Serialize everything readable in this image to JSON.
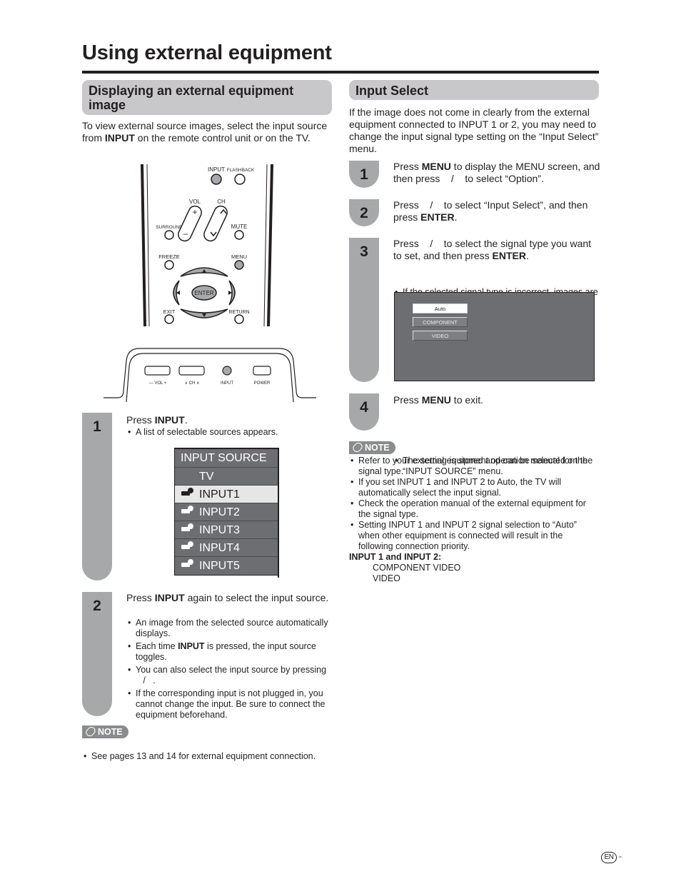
{
  "page": {
    "title": "Using external equipment",
    "footer_lang": "EN",
    "footer_dash": "-"
  },
  "left": {
    "heading": "Displaying an external equipment image",
    "intro_prefix": "To view external source images, select the input source from ",
    "intro_bold": "INPUT",
    "intro_suffix": " on the remote control unit or on the TV.",
    "remote": {
      "buttons": [
        "INPUT",
        "FLASHBACK",
        "VOL",
        "CH",
        "SURROUND",
        "MUTE",
        "FREEZE",
        "MENU",
        "ENTER",
        "EXIT",
        "RETURN"
      ]
    },
    "tv_panel": {
      "vol_label": "— VOL +",
      "ch_label": "∨ CH ∧",
      "input_label": "INPUT",
      "power_label": "POWER"
    },
    "steps": [
      {
        "number": "1",
        "text_prefix": "Press ",
        "text_bold": "INPUT",
        "text_suffix": ".",
        "bullets": [
          "A list of selectable sources appears."
        ]
      },
      {
        "number": "2",
        "text_prefix": "Press ",
        "text_bold": "INPUT",
        "text_suffix": " again to select the input source.",
        "bullets": [
          "An image from the selected source automatically displays.",
          "Each time INPUT is pressed, the input source toggles.",
          "You can also select the input source by pressing    /   .",
          "If the corresponding input is not plugged in, you cannot change the input. Be sure to connect the equipment beforehand."
        ],
        "bullet2_prefix": "Each time ",
        "bullet2_bold": "INPUT",
        "bullet2_suffix": " is pressed, the input source toggles."
      }
    ],
    "input_source_menu": {
      "title": "INPUT SOURCE",
      "items": [
        {
          "label": "TV",
          "selected": false
        },
        {
          "label": "INPUT1",
          "selected": true
        },
        {
          "label": "INPUT2",
          "selected": false
        },
        {
          "label": "INPUT3",
          "selected": false
        },
        {
          "label": "INPUT4",
          "selected": false
        },
        {
          "label": "INPUT5",
          "selected": false
        }
      ]
    },
    "note": {
      "badge": "NOTE",
      "items": [
        "See pages 13 and 14 for external equipment connection."
      ]
    }
  },
  "right": {
    "heading": "Input Select",
    "intro": "If the image does not come in clearly from the external equipment connected to INPUT 1 or 2, you may need to change the input signal type setting on the “Input Select” menu.",
    "steps": [
      {
        "number": "1",
        "a": "Press ",
        "b": "MENU",
        "c": " to display the MENU screen, and then press    /    to select “Option”."
      },
      {
        "number": "2",
        "a": "Press    /    to select “Input Select”, and then press ",
        "b": "ENTER",
        "c": "."
      },
      {
        "number": "3",
        "a": "Press    /    to select the signal type you want to set, and then press ",
        "b": "ENTER",
        "c": ".",
        "bullets": [
          "If the selected signal type is incorrect, images are not displayed or displayed without any color."
        ]
      },
      {
        "number": "4",
        "a": "Press ",
        "b": "MENU",
        "c": " to exit.",
        "bullets": [
          "The setting is stored and can be selected on the “INPUT SOURCE” menu."
        ]
      }
    ],
    "signal_menu": {
      "options": [
        {
          "label": "Auto",
          "selected": true
        },
        {
          "label": "COMPONENT",
          "selected": false
        },
        {
          "label": "VIDEO",
          "selected": false
        }
      ]
    },
    "note": {
      "badge": "NOTE",
      "items": [
        "Refer to your external equipment operation manual for the signal type.",
        "If you set INPUT 1 and INPUT 2 to Auto, the TV will automatically select the input signal.",
        "Check the operation manual of the external equipment for the signal type.",
        "Setting INPUT 1 and INPUT 2 signal selection to “Auto” when other equipment is connected will result in the following connection priority."
      ],
      "priority_heading": "INPUT 1 and INPUT 2:",
      "priority": [
        "COMPONENT VIDEO",
        "VIDEO"
      ]
    }
  },
  "colors": {
    "heading_bg": "#c8c8ca",
    "step_tab": "#a7a8aa",
    "menu_bg": "#6d6e71",
    "note_badge": "#8a8b8d",
    "text": "#231f20"
  }
}
